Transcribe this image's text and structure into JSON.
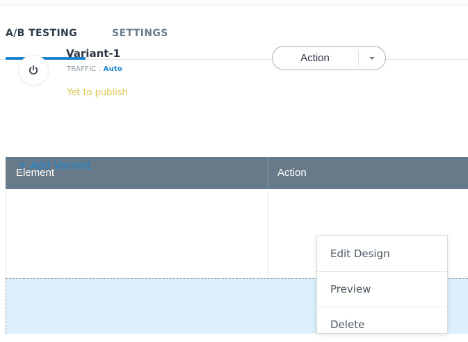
{
  "tabs": [
    {
      "label": "A/B TESTING"
    },
    {
      "label": "SETTINGS"
    }
  ],
  "table": {
    "headers": {
      "element": "Element",
      "action": "Action"
    },
    "rows": [
      {
        "name": "Variant-1",
        "traffic_label": "TRAFFIC :",
        "traffic_value": "Auto",
        "status": "Yet to publish",
        "action_label": "Action"
      }
    ],
    "add_variant": "+ Add Variant"
  },
  "dropdown_menu": {
    "items": [
      {
        "label": "Edit Design"
      },
      {
        "label": "Preview"
      },
      {
        "label": "Delete"
      }
    ]
  },
  "icons": {
    "power": "power-icon",
    "caret": "caret-down-icon"
  },
  "colors": {
    "accent": "#1b84cf",
    "header_bg": "#667a89",
    "status_pending": "#d8c447",
    "add_zone_bg": "#dcf0fb"
  }
}
